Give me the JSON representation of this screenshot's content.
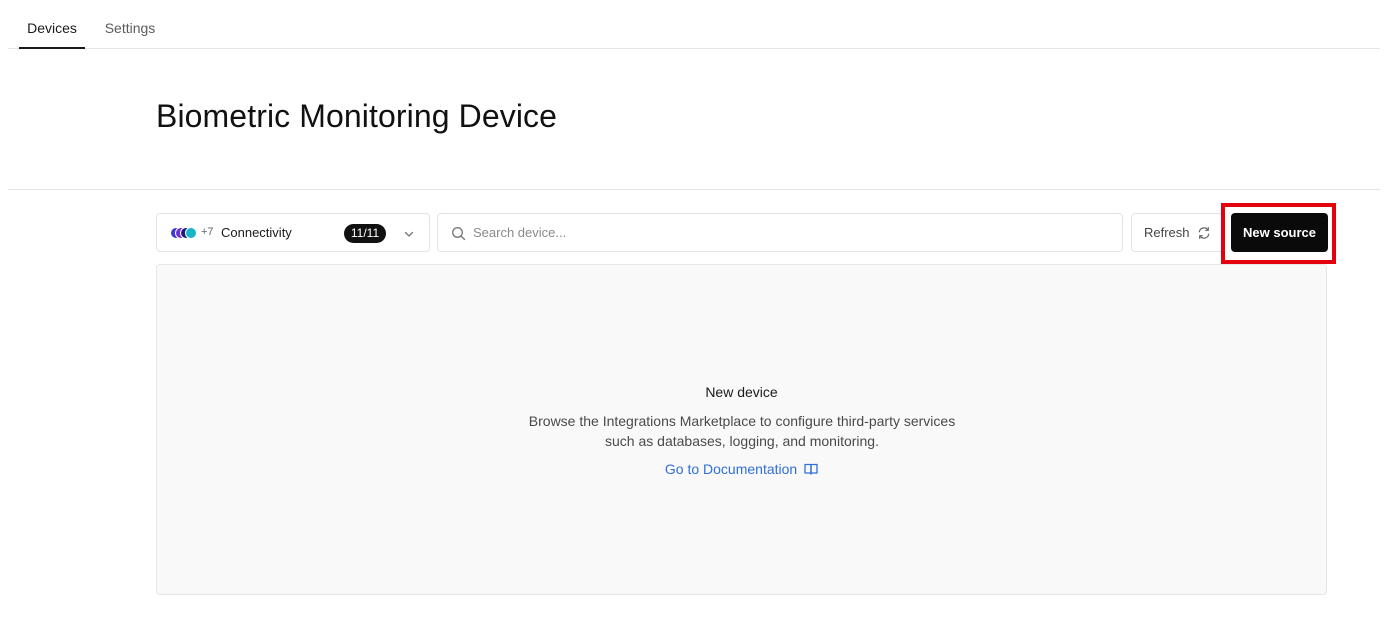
{
  "tabs": [
    {
      "label": "Devices",
      "active": true
    },
    {
      "label": "Settings",
      "active": false
    }
  ],
  "page": {
    "title": "Biometric Monitoring Device"
  },
  "filter": {
    "extra_count": "+7",
    "label": "Connectivity",
    "badge": "11/11",
    "dot_colors": [
      "#3b3bd1",
      "#6b2fd6",
      "#1d1d7a",
      "#17b4c8"
    ],
    "icon": "chevron-down-icon"
  },
  "search": {
    "placeholder": "Search device...",
    "value": "",
    "icon": "search-icon"
  },
  "toolbar": {
    "refresh_label": "Refresh",
    "refresh_icon": "refresh-icon",
    "new_source_label": "New source"
  },
  "empty_state": {
    "title": "New device",
    "description_line1": "Browse the Integrations Marketplace to configure third-party services",
    "description_line2": "such as databases, logging, and monitoring.",
    "link_label": "Go to Documentation",
    "link_icon": "book-icon"
  },
  "colors": {
    "accent_link": "#2f6fd8",
    "highlight": "#e3000f",
    "primary_button": "#0a0a0a"
  }
}
